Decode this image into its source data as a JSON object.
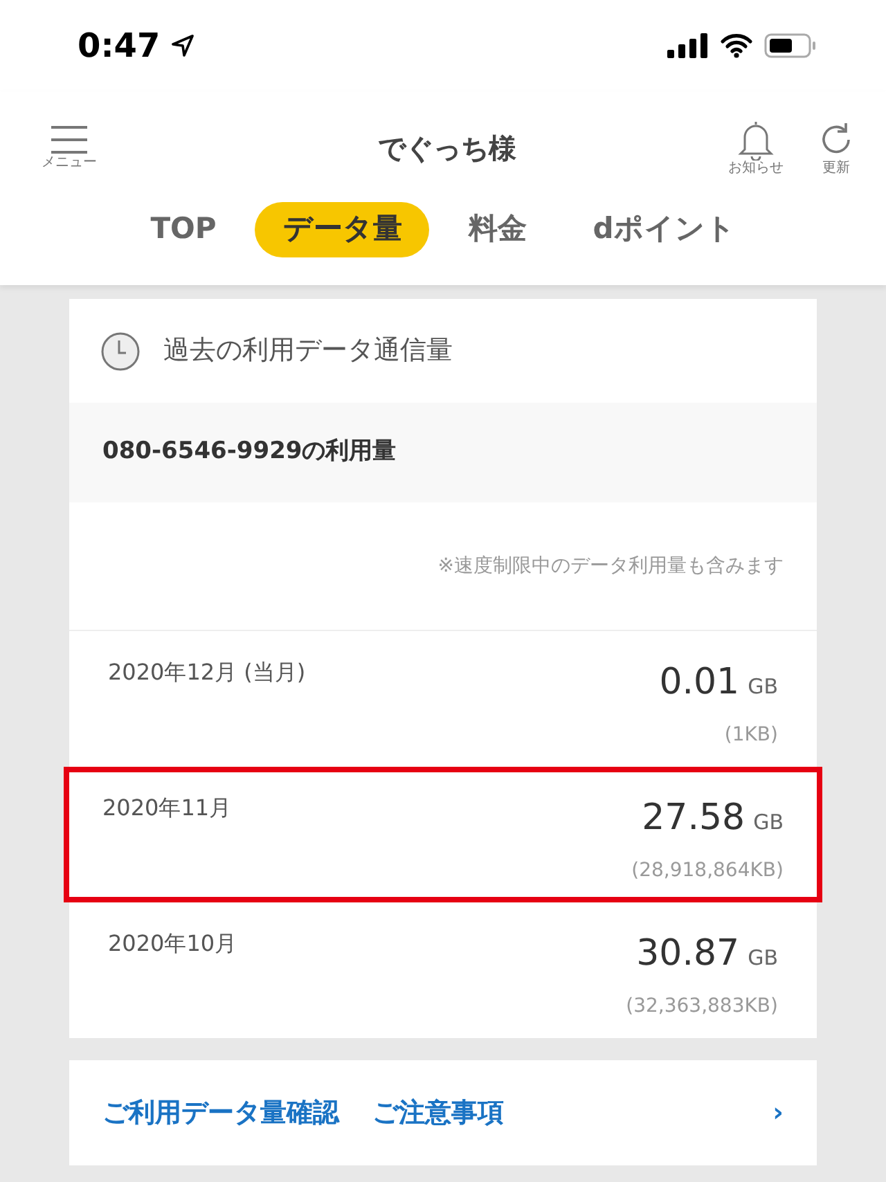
{
  "status_bar": {
    "time": "0:47"
  },
  "header": {
    "menu_label": "メニュー",
    "title": "でぐっち様",
    "actions": [
      {
        "kind": "bell",
        "label": "お知らせ"
      },
      {
        "kind": "refresh",
        "label": "更新"
      }
    ]
  },
  "tabs": [
    {
      "label": "TOP",
      "selected": false
    },
    {
      "label": "データ量",
      "selected": true
    },
    {
      "label": "料金",
      "selected": false
    },
    {
      "label": "dポイント",
      "selected": false
    }
  ],
  "card": {
    "title": "過去の利用データ通信量",
    "line_label": "080-6546-9929の利用量",
    "note": "※速度制限中のデータ利用量も含みます",
    "rows": [
      {
        "month": "2020年12月 (当月)",
        "amount": "0.01",
        "unit": "GB",
        "kb": "(1KB)",
        "highlighted": false
      },
      {
        "month": "2020年11月",
        "amount": "27.58",
        "unit": "GB",
        "kb": "(28,918,864KB)",
        "highlighted": true
      },
      {
        "month": "2020年10月",
        "amount": "30.87",
        "unit": "GB",
        "kb": "(32,363,883KB)",
        "highlighted": false
      }
    ]
  },
  "links": {
    "items": [
      "ご利用データ量確認",
      "ご注意事項"
    ],
    "chevron": "›"
  }
}
